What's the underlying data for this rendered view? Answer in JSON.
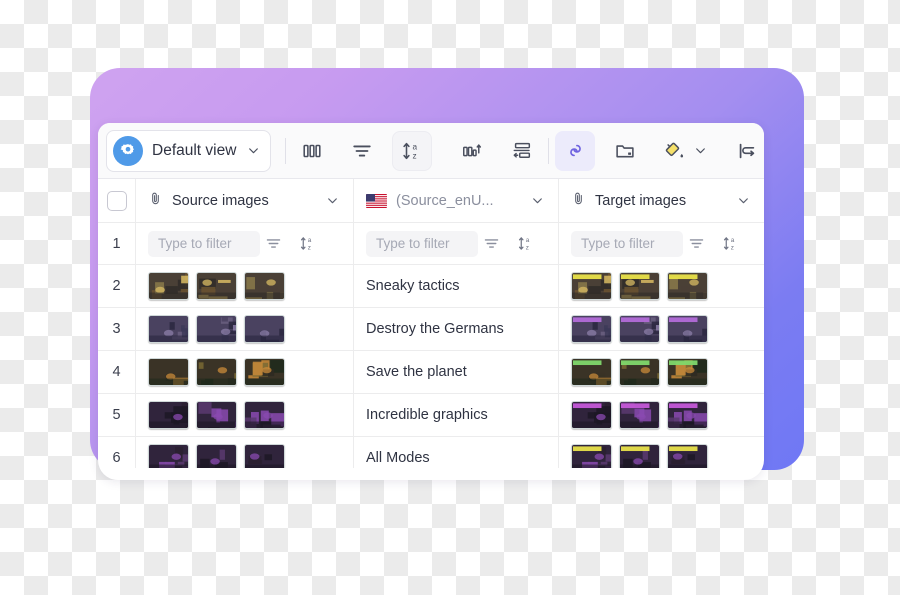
{
  "toolbar": {
    "view_name": "Default view",
    "gear_icon": "gear-icon",
    "view_chevron_icon": "chevron-down-icon",
    "buttons": [
      {
        "name": "columns-button",
        "icon": "columns-icon",
        "label": "Columns",
        "active": false,
        "boxed": false
      },
      {
        "name": "filter-button",
        "icon": "filter-icon",
        "label": "Filter",
        "active": false,
        "boxed": false
      },
      {
        "name": "sort-button",
        "icon": "sort-az-icon",
        "label": "Sort",
        "active": false,
        "boxed": true
      },
      {
        "name": "group-button",
        "icon": "group-columns-icon",
        "label": "Group",
        "active": false,
        "boxed": false
      },
      {
        "name": "row-height-button",
        "icon": "row-height-icon",
        "label": "Row height",
        "active": false,
        "boxed": false
      },
      {
        "name": "link-button",
        "icon": "link-icon",
        "label": "Link",
        "active": true,
        "boxed": false
      },
      {
        "name": "folder-button",
        "icon": "folder-icon",
        "label": "Folder",
        "active": false,
        "boxed": false
      },
      {
        "name": "fill-color-button",
        "icon": "paint-bucket-icon",
        "label": "Fill color",
        "active": false,
        "boxed": false
      },
      {
        "name": "wrap-text-button",
        "icon": "wrap-text-icon",
        "label": "Wrap text",
        "active": false,
        "boxed": false
      }
    ],
    "fill_chevron_icon": "chevron-down-icon"
  },
  "table": {
    "select_all_checkbox": "select-all-checkbox",
    "columns": [
      {
        "key": "source",
        "label": "Source images",
        "icon": "paperclip-icon",
        "muted": false,
        "chevron": "chevron-down-icon"
      },
      {
        "key": "text",
        "label": "(Source_enU...",
        "icon": "us-flag-icon",
        "muted": true,
        "chevron": "chevron-down-icon"
      },
      {
        "key": "target",
        "label": "Target images",
        "icon": "paperclip-icon",
        "muted": false,
        "chevron": "chevron-down-icon"
      }
    ],
    "filter_row": {
      "row_number": "1",
      "placeholder": "Type to filter",
      "filter_icon": "filter-icon",
      "sort_icon": "sort-az-icon"
    },
    "rows": [
      {
        "num": "2",
        "text": "Sneaky tactics",
        "src_thumbs": 3,
        "tgt_thumbs": 3,
        "palette": "gold",
        "banner": "#e8e14a"
      },
      {
        "num": "3",
        "text": "Destroy the Germans",
        "src_thumbs": 3,
        "tgt_thumbs": 3,
        "palette": "blue",
        "banner": "#b26bd8"
      },
      {
        "num": "4",
        "text": "Save the planet",
        "src_thumbs": 3,
        "tgt_thumbs": 3,
        "palette": "amber",
        "banner": "#7fd86b"
      },
      {
        "num": "5",
        "text": "Incredible graphics",
        "src_thumbs": 3,
        "tgt_thumbs": 3,
        "palette": "violet",
        "banner": "#c45ad8"
      },
      {
        "num": "6",
        "text": "All Modes",
        "src_thumbs": 3,
        "tgt_thumbs": 3,
        "palette": "violet",
        "banner": "#e8e14a"
      }
    ]
  },
  "colors": {
    "accent_purple": "#7a6ff0",
    "gradient_start": "#cfa3f0",
    "gradient_end": "#6f78f5",
    "gear_blue": "#4f9ae8",
    "link_active_bg": "#ecebfb",
    "bucket_yellow": "#f5e06a"
  }
}
